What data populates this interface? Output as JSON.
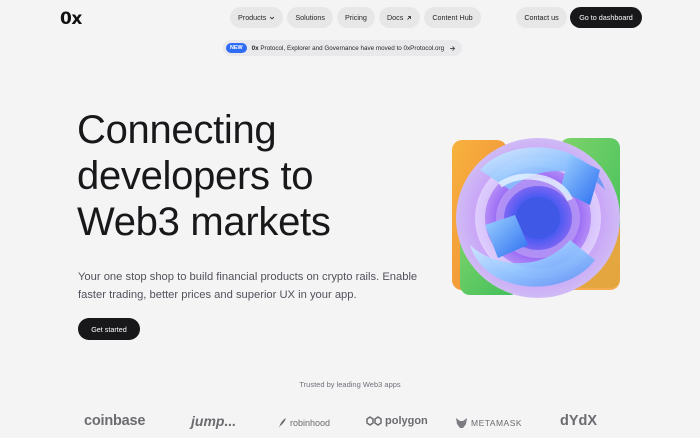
{
  "header": {
    "logo": "0x",
    "nav": [
      {
        "label": "Products",
        "icon": "chevron-down-icon"
      },
      {
        "label": "Solutions"
      },
      {
        "label": "Pricing"
      },
      {
        "label": "Docs",
        "icon": "arrow-up-right-icon"
      },
      {
        "label": "Content Hub"
      }
    ],
    "contact_label": "Contact us",
    "dashboard_label": "Go to dashboard"
  },
  "announcement": {
    "badge": "NEW",
    "brand": "0x",
    "text": "Protocol, Explorer and Governance have moved to 0xProtocol.org",
    "icon": "arrow-right-icon"
  },
  "hero": {
    "title_lines": [
      "Connecting",
      "developers to",
      "Web3 markets"
    ],
    "subtitle": "Your one stop shop to build financial products on crypto rails. Enable faster trading, better prices and superior UX in your app.",
    "cta": "Get started"
  },
  "trusted": {
    "heading": "Trusted by leading Web3 apps",
    "logos": [
      "coinbase",
      "jump...",
      "robinhood",
      "polygon",
      "METAMASK",
      "dYdX"
    ]
  },
  "colors": {
    "background": "#f4f4f5",
    "primary_dark": "#18181b",
    "badge_blue": "#2f6cf6"
  }
}
